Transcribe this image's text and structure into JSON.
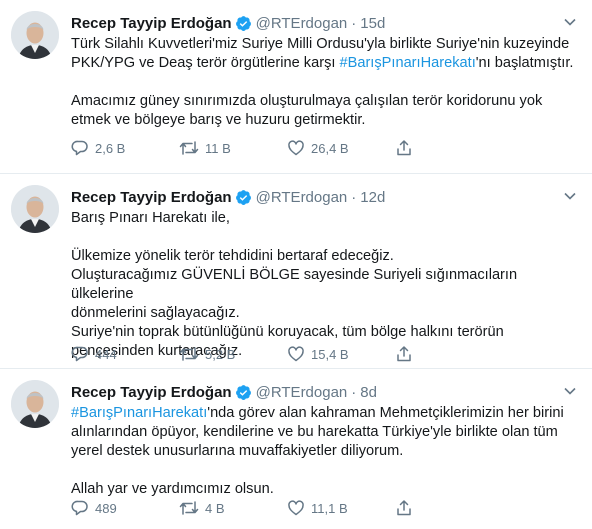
{
  "tweets": [
    {
      "author": {
        "name": "Recep Tayyip Erdoğan",
        "handle": "@RTErdogan"
      },
      "time": "15d",
      "dot": "·",
      "lines": [
        {
          "parts": [
            "Türk Silahlı Kuvvetleri'miz Suriye Milli Ordusu'yla birlikte Suriye'nin kuzeyinde"
          ]
        },
        {
          "parts": [
            "PKK/YPG ve Deaş terör örgütlerine karşı ",
            "#BarışPınarıHarekatı",
            "'nı başlatmıştır."
          ]
        },
        {
          "parts": []
        },
        {
          "parts": [
            "Amacımız güney sınırımızda oluşturulmaya çalışılan terör koridorunu yok"
          ]
        },
        {
          "parts": [
            "etmek ve bölgeye barış ve huzuru getirmektir."
          ]
        }
      ],
      "replies": "2,6 B",
      "retweets": "11 B",
      "likes": "26,4 B"
    },
    {
      "author": {
        "name": "Recep Tayyip Erdoğan",
        "handle": "@RTErdogan"
      },
      "time": "12d",
      "dot": "·",
      "lines": [
        {
          "parts": [
            "Barış Pınarı Harekatı ile,"
          ]
        },
        {
          "parts": []
        },
        {
          "parts": [
            "Ülkemize yönelik terör tehdidini bertaraf edeceğiz."
          ]
        },
        {
          "parts": [
            "Oluşturacağımız GÜVENLİ BÖLGE sayesinde Suriyeli sığınmacıların ülkelerine"
          ]
        },
        {
          "parts": [
            "dönmelerini sağlayacağız."
          ]
        },
        {
          "parts": [
            "Suriye'nin toprak bütünlüğünü koruyacak, tüm bölge halkını terörün"
          ]
        },
        {
          "parts": [
            "pençesinden kurtaracağız."
          ]
        }
      ],
      "replies": "444",
      "retweets": "5,2 B",
      "likes": "15,4 B"
    },
    {
      "author": {
        "name": "Recep Tayyip Erdoğan",
        "handle": "@RTErdogan"
      },
      "time": "8d",
      "dot": "·",
      "lines": [
        {
          "parts": [
            "",
            "#BarışPınarıHarekatı",
            "'nda görev alan kahraman Mehmetçiklerimizin her birini"
          ]
        },
        {
          "parts": [
            "alınlarından öpüyor, kendilerine ve bu harekatta Türkiye'yle birlikte olan tüm"
          ]
        },
        {
          "parts": [
            "yerel destek unusurlarına muvaffakiyetler diliyorum."
          ]
        },
        {
          "parts": []
        },
        {
          "parts": [
            "Allah yar ve yardımcımız olsun."
          ]
        }
      ],
      "replies": "489",
      "retweets": "4 B",
      "likes": "11,1 B"
    }
  ],
  "colors": {
    "accent": "#1b95e0",
    "muted": "#657786",
    "text": "#14171a",
    "verified": "#1da1f2"
  },
  "icons": [
    "verified-badge-icon",
    "chevron-down-icon",
    "reply-icon",
    "retweet-icon",
    "like-icon",
    "share-icon"
  ]
}
